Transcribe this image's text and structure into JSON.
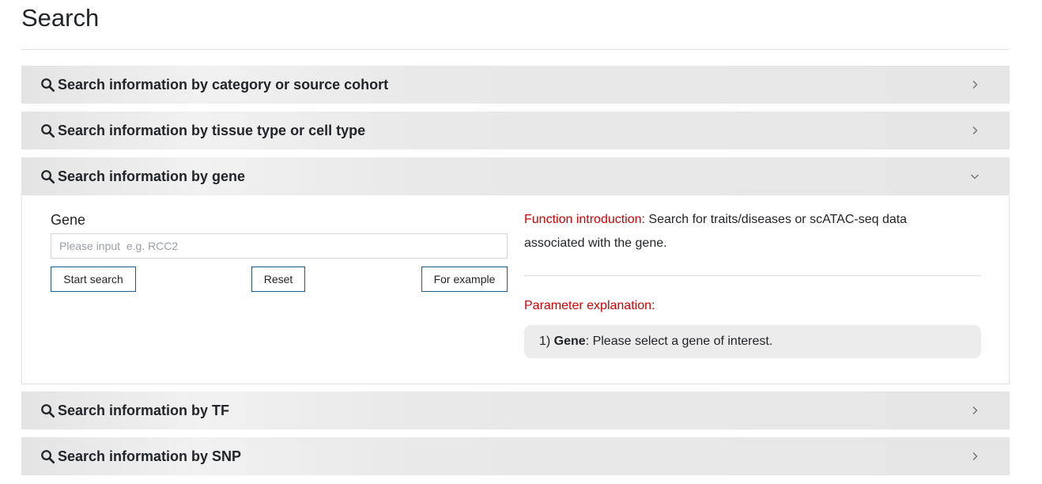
{
  "page": {
    "title": "Search"
  },
  "panels": [
    {
      "label": "Search information by category or source cohort",
      "expanded": false
    },
    {
      "label": "Search information by tissue type or cell type",
      "expanded": false
    },
    {
      "label": "Search information by gene",
      "expanded": true
    },
    {
      "label": "Search information by TF",
      "expanded": false
    },
    {
      "label": "Search information by SNP",
      "expanded": false
    }
  ],
  "gene_form": {
    "field_label": "Gene",
    "input_value": "",
    "input_placeholder": "Please input  e.g. RCC2",
    "start_search_label": "Start search",
    "reset_label": "Reset",
    "example_label": "For example"
  },
  "info": {
    "function_intro_label": "Function introduction:",
    "function_intro_text": " Search for traits/diseases or scATAC-seq data associated with the gene.",
    "param_title": "Parameter explanation:",
    "param_prefix": "1) ",
    "param_name": "Gene",
    "param_desc": ": Please select a gene of interest."
  },
  "icons": {
    "panel_icon": "search-icon",
    "collapsed_icon": "chevron-right-icon",
    "expanded_icon": "chevron-down-icon"
  },
  "colors": {
    "accent_red": "#d40000",
    "button_border": "#1d5a8a",
    "header_bg": "#e6e6e6"
  }
}
